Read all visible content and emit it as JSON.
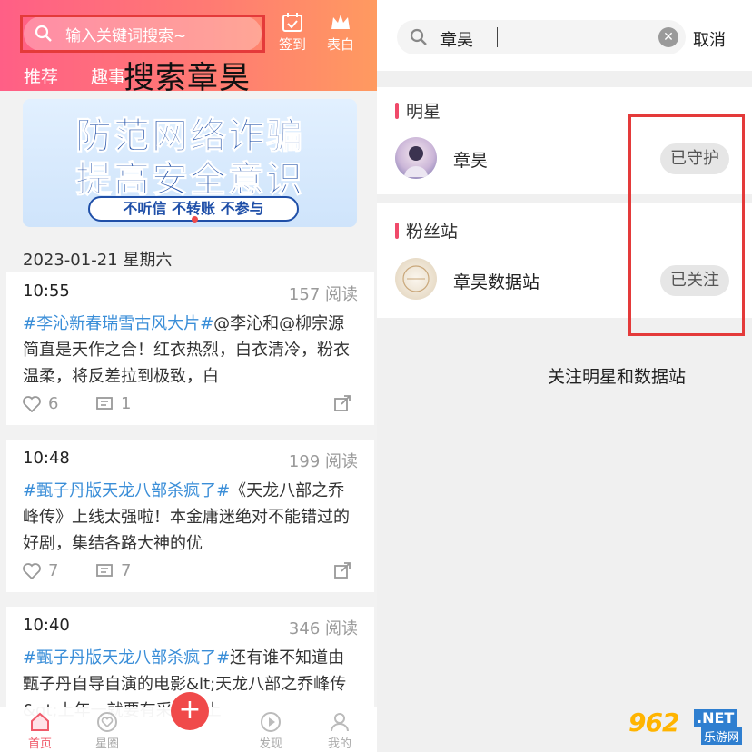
{
  "left": {
    "search": {
      "placeholder": "输入关键词搜索~"
    },
    "header_buttons": {
      "sign_in": "签到",
      "confession": "表白"
    },
    "tabs": [
      "推荐",
      "趣事"
    ],
    "overlay_label": "搜索章昊",
    "banner": {
      "line1": "防范网络诈骗",
      "line2": "提高安全意识",
      "pill": "不听信  不转账  不参与"
    },
    "date": "2023-01-21 星期六",
    "posts": [
      {
        "time": "10:55",
        "reads": "157 阅读",
        "tag": "#李沁新春瑞雪古风大片#",
        "text": "@李沁和@柳宗源简直是天作之合！红衣热烈，白衣清冷，粉衣温柔，将反差拉到极致，白",
        "likes": "6",
        "comments": "1"
      },
      {
        "time": "10:48",
        "reads": "199 阅读",
        "tag": "#甄子丹版天龙八部杀疯了#",
        "text": "《天龙八部之乔峰传》上线太强啦！本金庸迷绝对不能错过的好剧，集结各路大神的优",
        "likes": "7",
        "comments": "7"
      },
      {
        "time": "10:40",
        "reads": "346 阅读",
        "tag": "#甄子丹版天龙八部杀疯了#",
        "text": "还有谁不知道由甄子丹自导自演的电影&lt;天龙八部之乔峰传&gt;上年一就要有采代腾上"
      }
    ],
    "fab": "+",
    "nav": [
      "首页",
      "星圈",
      "发现",
      "我的"
    ]
  },
  "right": {
    "search": {
      "query": "章昊",
      "cancel": "取消"
    },
    "sections": [
      {
        "title": "明星",
        "name": "章昊",
        "button": "已守护"
      },
      {
        "title": "粉丝站",
        "name": "章昊数据站",
        "button": "已关注"
      }
    ],
    "note": "关注明星和数据站"
  },
  "watermark": {
    "number": "962",
    "net": ".NET",
    "sub": "乐游网"
  },
  "colors": {
    "accent": "#f04a6a",
    "tag_blue": "#3a8ed8",
    "highlight_red": "#e43a3a"
  }
}
